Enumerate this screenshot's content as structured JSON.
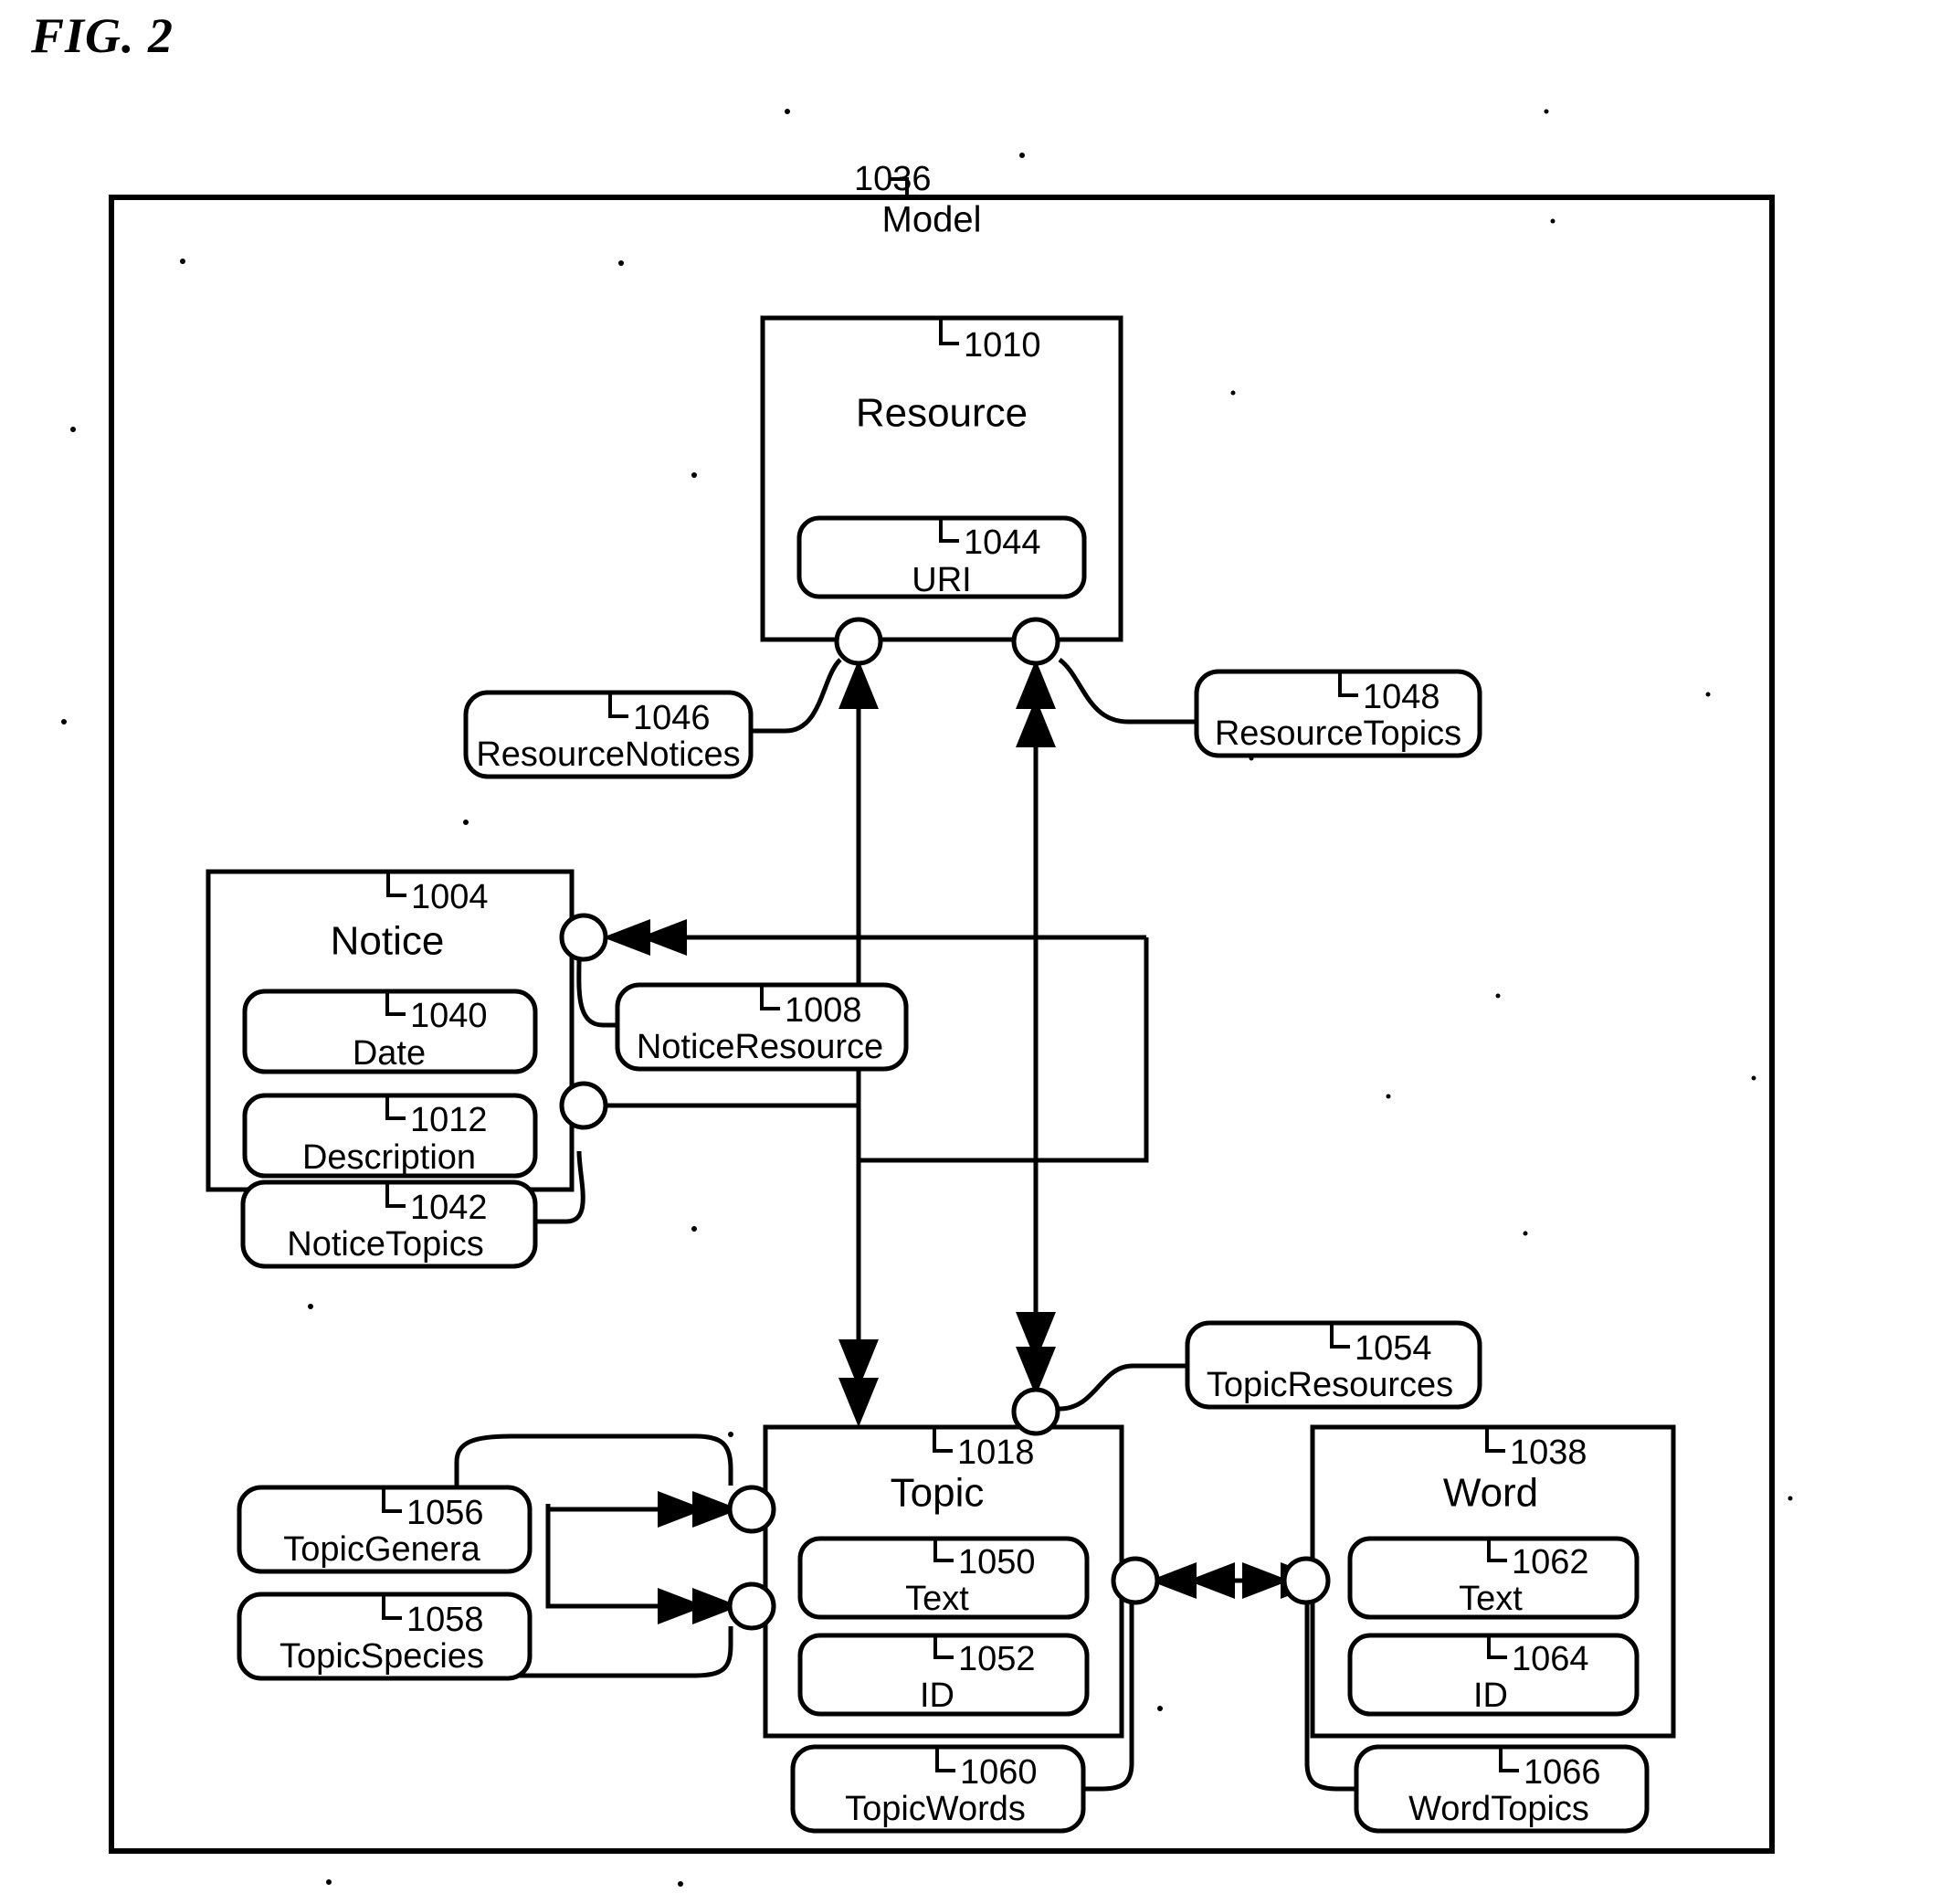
{
  "figure": {
    "label": "FIG. 2",
    "container": {
      "ref": "1036",
      "name": "Model"
    }
  },
  "entities": [
    {
      "id": "resource",
      "ref": "1010",
      "name": "Resource",
      "attributes": [
        {
          "ref": "1044",
          "name": "URI"
        }
      ]
    },
    {
      "id": "notice",
      "ref": "1004",
      "name": "Notice",
      "attributes": [
        {
          "ref": "1040",
          "name": "Date"
        },
        {
          "ref": "1012",
          "name": "Description"
        }
      ]
    },
    {
      "id": "topic",
      "ref": "1018",
      "name": "Topic",
      "attributes": [
        {
          "ref": "1050",
          "name": "Text"
        },
        {
          "ref": "1052",
          "name": "ID"
        }
      ]
    },
    {
      "id": "word",
      "ref": "1038",
      "name": "Word",
      "attributes": [
        {
          "ref": "1062",
          "name": "Text"
        },
        {
          "ref": "1064",
          "name": "ID"
        }
      ]
    }
  ],
  "relationships": [
    {
      "id": "resource-notices",
      "ref": "1046",
      "name": "ResourceNotices"
    },
    {
      "id": "resource-topics",
      "ref": "1048",
      "name": "ResourceTopics"
    },
    {
      "id": "notice-resource",
      "ref": "1008",
      "name": "NoticeResource"
    },
    {
      "id": "notice-topics",
      "ref": "1042",
      "name": "NoticeTopics"
    },
    {
      "id": "topic-resources",
      "ref": "1054",
      "name": "TopicResources"
    },
    {
      "id": "topic-genera",
      "ref": "1056",
      "name": "TopicGenera"
    },
    {
      "id": "topic-species",
      "ref": "1058",
      "name": "TopicSpecies"
    },
    {
      "id": "topic-words",
      "ref": "1060",
      "name": "TopicWords"
    },
    {
      "id": "word-topics",
      "ref": "1066",
      "name": "WordTopics"
    }
  ],
  "colors": {
    "ink": "#000000",
    "paper": "#ffffff"
  }
}
